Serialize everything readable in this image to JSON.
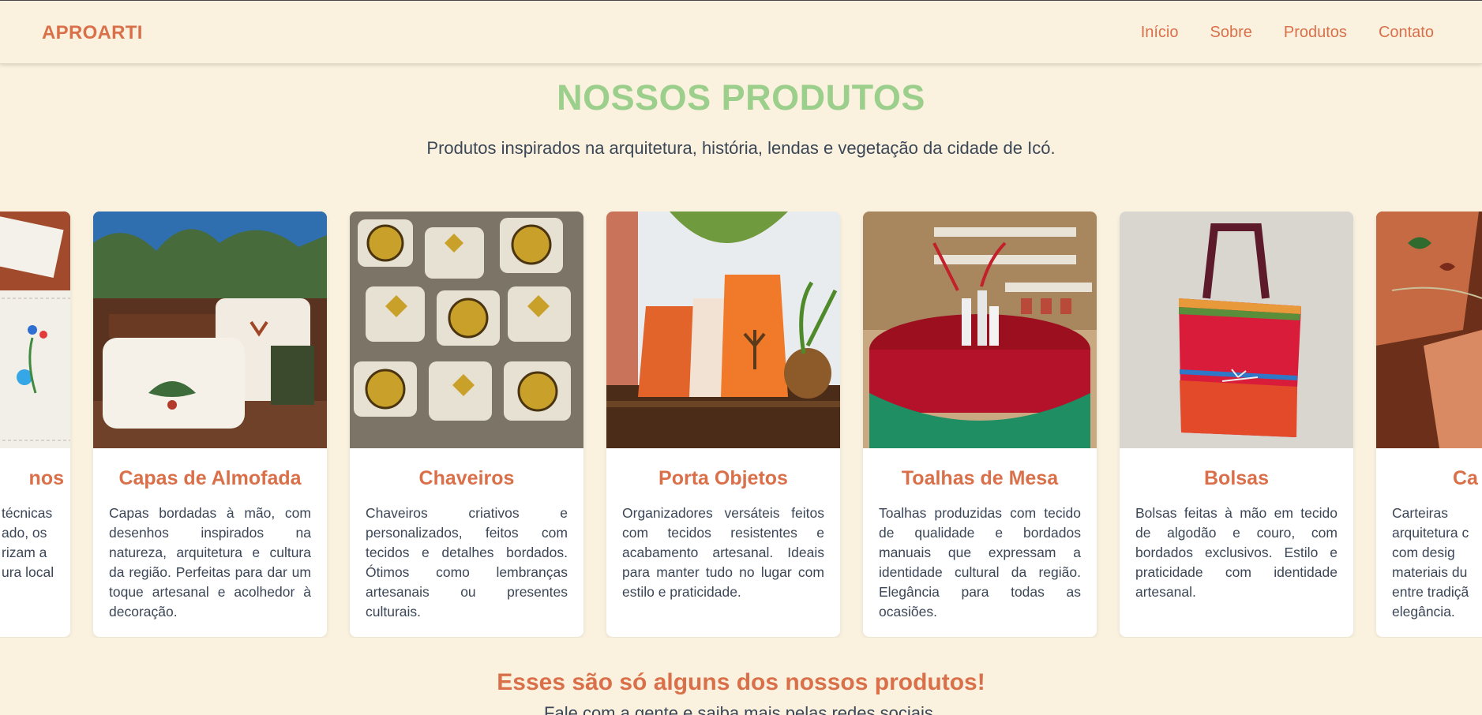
{
  "header": {
    "logo": "APROARTI",
    "nav": [
      "Início",
      "Sobre",
      "Produtos",
      "Contato"
    ]
  },
  "section": {
    "title": "NOSSOS PRODUTOS",
    "subtitle": "Produtos inspirados na arquitetura, história, lendas e vegetação da cidade de Icó."
  },
  "products": [
    {
      "title": "Panos",
      "title_visible": "nos",
      "text_visible": "técnicas\nado, os\nrizam a\nura local",
      "image": "embroidered-cloth-photo"
    },
    {
      "title": "Capas de Almofada",
      "text": "Capas bordadas à mão, com desenhos inspirados na natureza, arquitetura e cultura da região. Perfeitas para dar um toque artesanal e acolhedor à decoração.",
      "image": "cushion-covers-photo"
    },
    {
      "title": "Chaveiros",
      "text": "Chaveiros criativos e personalizados, feitos com tecidos e detalhes bordados. Ótimos como lembranças artesanais ou presentes culturais.",
      "image": "keychains-photo"
    },
    {
      "title": "Porta Objetos",
      "text": "Organizadores versáteis feitos com tecidos resistentes e acabamento artesanal. Ideais para manter tudo no lugar com estilo e praticidade.",
      "image": "fabric-pouches-photo"
    },
    {
      "title": "Toalhas de Mesa",
      "text": "Toalhas produzidas com tecido de qualidade e bordados manuais que expressam a identidade cultural da região. Elegância para todas as ocasiões.",
      "image": "tablecloth-photo"
    },
    {
      "title": "Bolsas",
      "text": "Bolsas feitas à mão em tecido de algodão e couro, com bordados exclusivos. Estilo e praticidade com identidade artesanal.",
      "image": "tote-bag-photo"
    },
    {
      "title": "Carteiras",
      "title_visible": "Ca",
      "text_visible": "Carteiras\narquitetura c\ncom desig\nmateriais du\nentre tradiçã\nelegância.",
      "image": "leather-wallets-photo"
    }
  ],
  "cta": {
    "title": "Esses são só alguns dos nossos produtos!",
    "subtitle": "Fale com a gente e saiba mais pelas redes sociais."
  },
  "colors": {
    "background": "#faf2df",
    "accent": "#d9704a",
    "title_green": "#9ccf8c",
    "text": "#3b4656"
  }
}
